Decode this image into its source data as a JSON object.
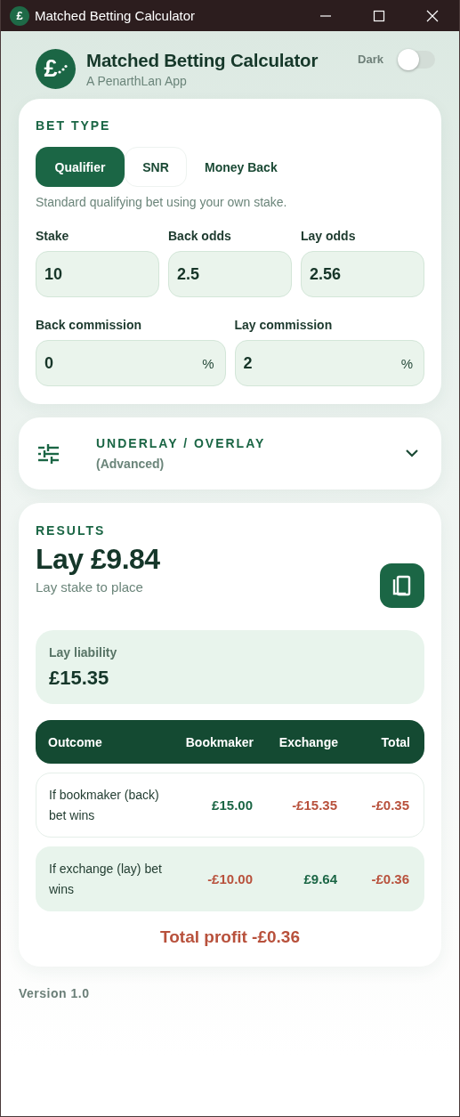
{
  "window": {
    "title": "Matched Betting Calculator",
    "app_icon": "£"
  },
  "header": {
    "logo": "£",
    "title": "Matched Betting Calculator",
    "subtitle": "A PenarthLan App",
    "dark_toggle": {
      "label": "Dark",
      "on": false
    }
  },
  "bet_type": {
    "heading": "BET TYPE",
    "tabs": [
      {
        "label": "Qualifier",
        "selected": true
      },
      {
        "label": "SNR",
        "selected": false
      },
      {
        "label": "Money Back",
        "selected": false
      }
    ],
    "description": "Standard qualifying bet using your own stake.",
    "field_rows": [
      {
        "fields": [
          {
            "label": "Stake",
            "value": "10"
          },
          {
            "label": "Back odds",
            "value": "2.5"
          },
          {
            "label": "Lay odds",
            "value": "2.56"
          }
        ]
      },
      {
        "fields": [
          {
            "label": "Back commission",
            "value": "0",
            "suffix": "%"
          },
          {
            "label": "Lay commission",
            "value": "2",
            "suffix": "%"
          }
        ]
      }
    ]
  },
  "advanced": {
    "title": "UNDERLAY / OVERLAY",
    "subtitle": "(Advanced)",
    "expanded": false
  },
  "results": {
    "heading": "RESULTS",
    "lay_stake": "Lay £9.84",
    "lay_stake_caption": "Lay stake to place",
    "liability": {
      "label": "Lay liability",
      "value": "£15.35"
    },
    "table": {
      "columns": [
        "Outcome",
        "Bookmaker",
        "Exchange",
        "Total"
      ],
      "rows": [
        {
          "shaded": false,
          "cells": [
            {
              "text": "If bookmaker (back) bet wins"
            },
            {
              "text": "£15.00",
              "color": "#1b6645"
            },
            {
              "text": "-£15.35",
              "color": "#b8513c"
            },
            {
              "text": "-£0.35",
              "color": "#b8513c"
            }
          ]
        },
        {
          "shaded": true,
          "cells": [
            {
              "text": "If exchange (lay) bet wins"
            },
            {
              "text": "-£10.00",
              "color": "#b8513c"
            },
            {
              "text": "£9.64",
              "color": "#1b6645"
            },
            {
              "text": "-£0.36",
              "color": "#b8513c"
            }
          ]
        }
      ]
    },
    "total_profit": {
      "text": "Total profit -£0.36",
      "color": "#b8513c"
    }
  },
  "footer": {
    "version": "Version 1.0"
  }
}
